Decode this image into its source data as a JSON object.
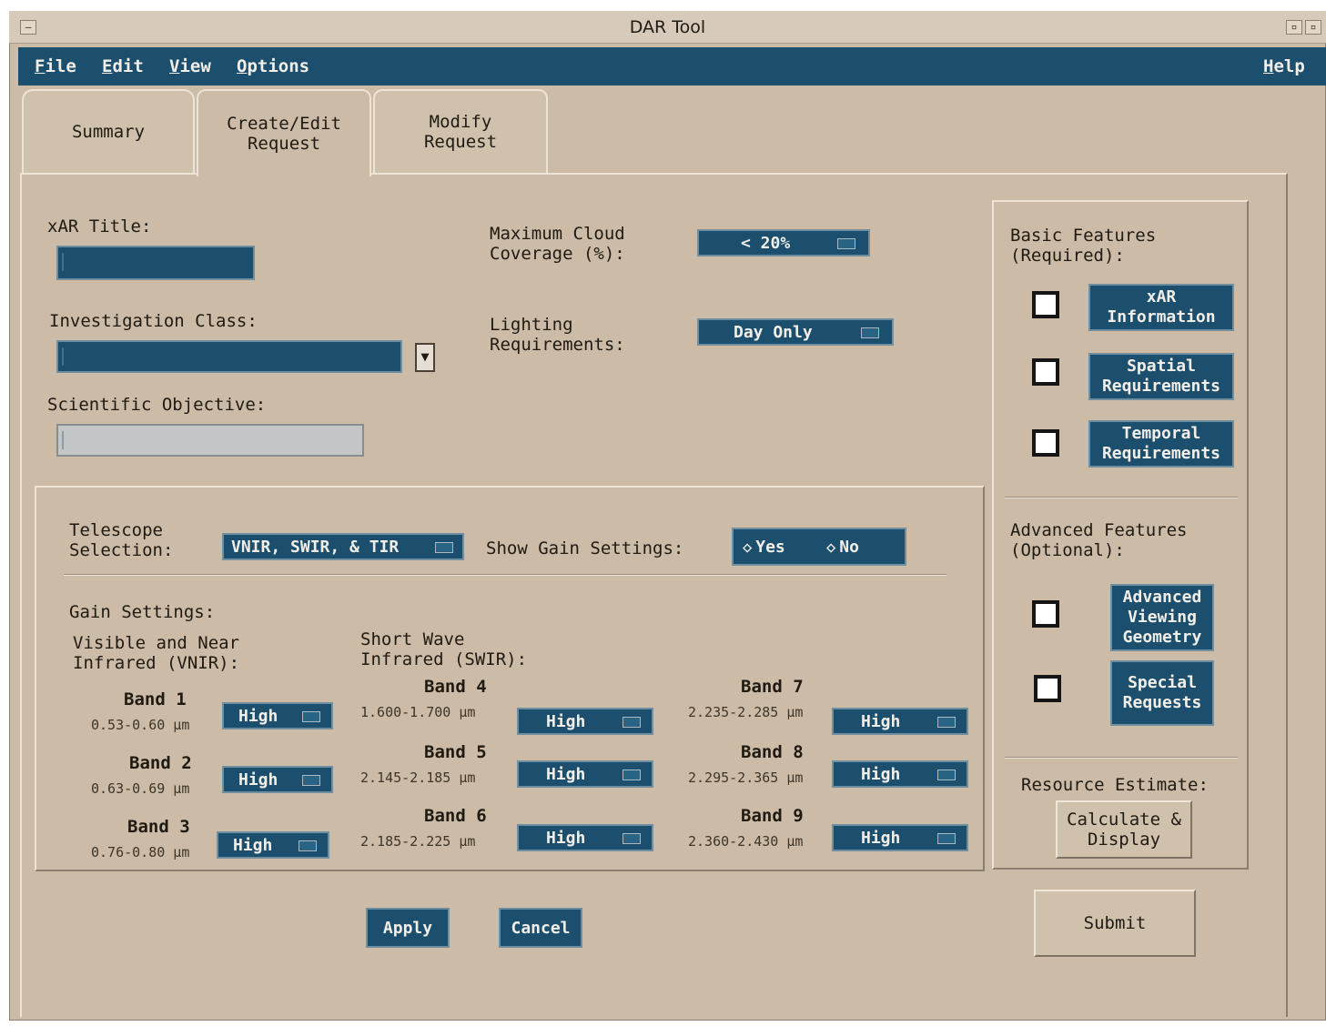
{
  "window": {
    "title": "DAR Tool",
    "title_buttons": [
      "–",
      "▫",
      "▫"
    ]
  },
  "menu": {
    "file": {
      "mnemonic": "F",
      "rest": "ile"
    },
    "edit": {
      "mnemonic": "E",
      "rest": "dit"
    },
    "view": {
      "mnemonic": "V",
      "rest": "iew"
    },
    "options": {
      "mnemonic": "O",
      "rest": "ptions"
    },
    "help": {
      "mnemonic": "H",
      "rest": "elp"
    }
  },
  "tabs": {
    "summary": "Summary",
    "create_edit": "Create/Edit\nRequest",
    "modify": "Modify\nRequest"
  },
  "form": {
    "xar_title_label": "xAR Title:",
    "xar_title_value": "",
    "investigation_class_label": "Investigation Class:",
    "investigation_class_value": "",
    "scientific_objective_label": "Scientific Objective:",
    "scientific_objective_value": "",
    "cloud_label": "Maximum Cloud\nCoverage (%):",
    "cloud_value": "< 20%",
    "lighting_label": "Lighting\nRequirements:",
    "lighting_value": "Day Only"
  },
  "telescope": {
    "selection_label": "Telescope\nSelection:",
    "selection_value": "VNIR, SWIR, & TIR",
    "show_gain_label": "Show Gain Settings:",
    "yes": "Yes",
    "no": "No",
    "gain_settings_label": "Gain Settings:",
    "vnir_label": "Visible and Near\nInfrared (VNIR):",
    "swir_label": "Short Wave\nInfrared (SWIR):"
  },
  "bands": {
    "b1": {
      "name": "Band  1",
      "range": "0.53-0.60  µm",
      "gain": "High"
    },
    "b2": {
      "name": "Band  2",
      "range": "0.63-0.69  µm",
      "gain": "High"
    },
    "b3": {
      "name": "Band  3",
      "range": "0.76-0.80 µm",
      "gain": "High"
    },
    "b4": {
      "name": "Band  4",
      "range": "1.600-1.700  µm",
      "gain": "High"
    },
    "b5": {
      "name": "Band  5",
      "range": "2.145-2.185  µm",
      "gain": "High"
    },
    "b6": {
      "name": "Band  6",
      "range": "2.185-2.225  µm",
      "gain": "High"
    },
    "b7": {
      "name": "Band  7",
      "range": "2.235-2.285 µm",
      "gain": "High"
    },
    "b8": {
      "name": "Band  8",
      "range": "2.295-2.365 µm",
      "gain": "High"
    },
    "b9": {
      "name": "Band  9",
      "range": "2.360-2.430 µm",
      "gain": "High"
    }
  },
  "features": {
    "basic_label": "Basic Features\n(Required):",
    "xar_info": "xAR\nInformation",
    "spatial": "Spatial\nRequirements",
    "temporal": "Temporal\nRequirements",
    "advanced_label": "Advanced Features\n(Optional):",
    "adv_viewing": "Advanced\nViewing\nGeometry",
    "special": "Special\nRequests",
    "resource_label": "Resource Estimate:",
    "calculate": "Calculate &\nDisplay"
  },
  "actions": {
    "apply": "Apply",
    "cancel": "Cancel",
    "submit": "Submit"
  },
  "colors": {
    "background": "#ccbba6",
    "accent": "#1c4f6e"
  }
}
